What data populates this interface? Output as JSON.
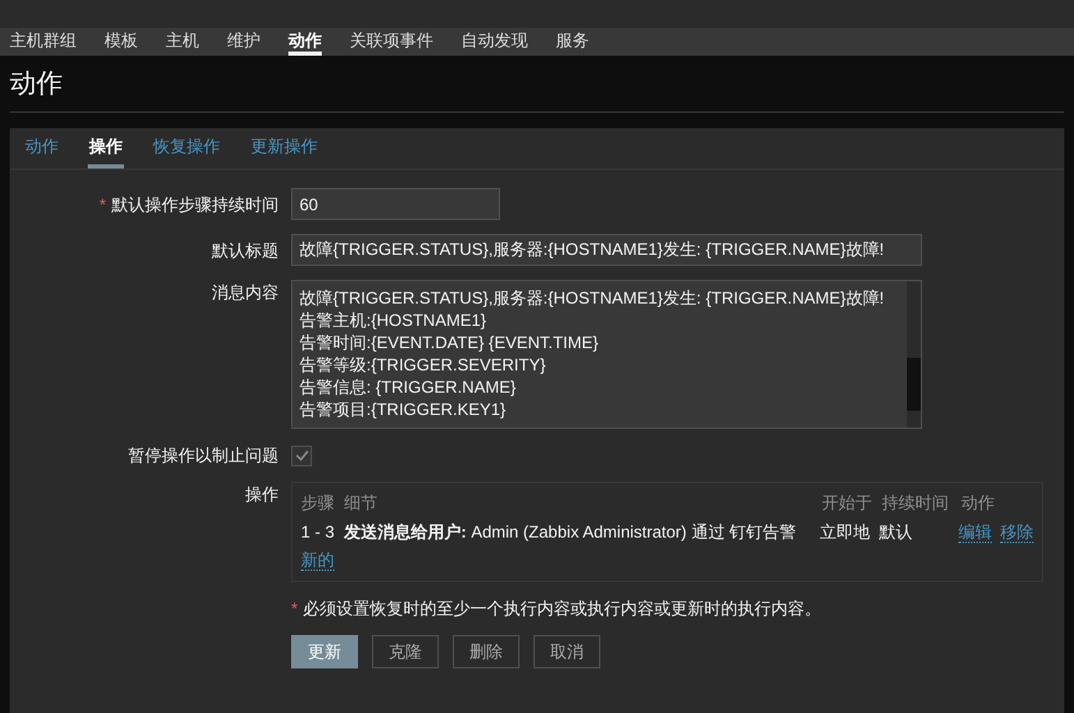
{
  "nav": [
    {
      "label": "主机群组",
      "selected": false
    },
    {
      "label": "模板",
      "selected": false
    },
    {
      "label": "主机",
      "selected": false
    },
    {
      "label": "维护",
      "selected": false
    },
    {
      "label": "动作",
      "selected": true
    },
    {
      "label": "关联项事件",
      "selected": false
    },
    {
      "label": "自动发现",
      "selected": false
    },
    {
      "label": "服务",
      "selected": false
    }
  ],
  "page_title": "动作",
  "tabs": [
    {
      "label": "动作",
      "selected": false
    },
    {
      "label": "操作",
      "selected": true
    },
    {
      "label": "恢复操作",
      "selected": false
    },
    {
      "label": "更新操作",
      "selected": false
    }
  ],
  "form": {
    "step_duration": {
      "label": "默认操作步骤持续时间",
      "required": true,
      "required_mark": "*",
      "value": "60"
    },
    "subject": {
      "label": "默认标题",
      "value": "故障{TRIGGER.STATUS},服务器:{HOSTNAME1}发生: {TRIGGER.NAME}故障!"
    },
    "message": {
      "label": "消息内容",
      "lines": [
        "故障{TRIGGER.STATUS},服务器:{HOSTNAME1}发生: {TRIGGER.NAME}故障!",
        "告警主机:{HOSTNAME1}",
        "告警时间:{EVENT.DATE} {EVENT.TIME}",
        "告警等级:{TRIGGER.SEVERITY}",
        "告警信息: {TRIGGER.NAME}",
        "告警项目:{TRIGGER.KEY1}"
      ]
    },
    "pause": {
      "label": "暂停操作以制止问题",
      "checked": true,
      "disabled": true
    },
    "operations": {
      "label": "操作",
      "columns": [
        "步骤",
        "细节",
        "开始于",
        "持续时间",
        "动作"
      ],
      "rows": [
        {
          "steps": "1 - 3",
          "details": "**发送消息给用户:** Admin (Zabbix Administrator) 通过 钉钉告警",
          "start_in": "立即地",
          "duration": "默认",
          "actions": [
            "编辑",
            "移除"
          ]
        }
      ],
      "new_link": "新的"
    },
    "note": {
      "mark": "*",
      "text": "必须设置恢复时的至少一个执行内容或执行内容或更新时的执行内容。"
    }
  },
  "buttons": [
    {
      "label": "更新",
      "kind": "primary"
    },
    {
      "label": "克隆",
      "kind": "secondary"
    },
    {
      "label": "删除",
      "kind": "secondary"
    },
    {
      "label": "取消",
      "kind": "secondary"
    }
  ]
}
